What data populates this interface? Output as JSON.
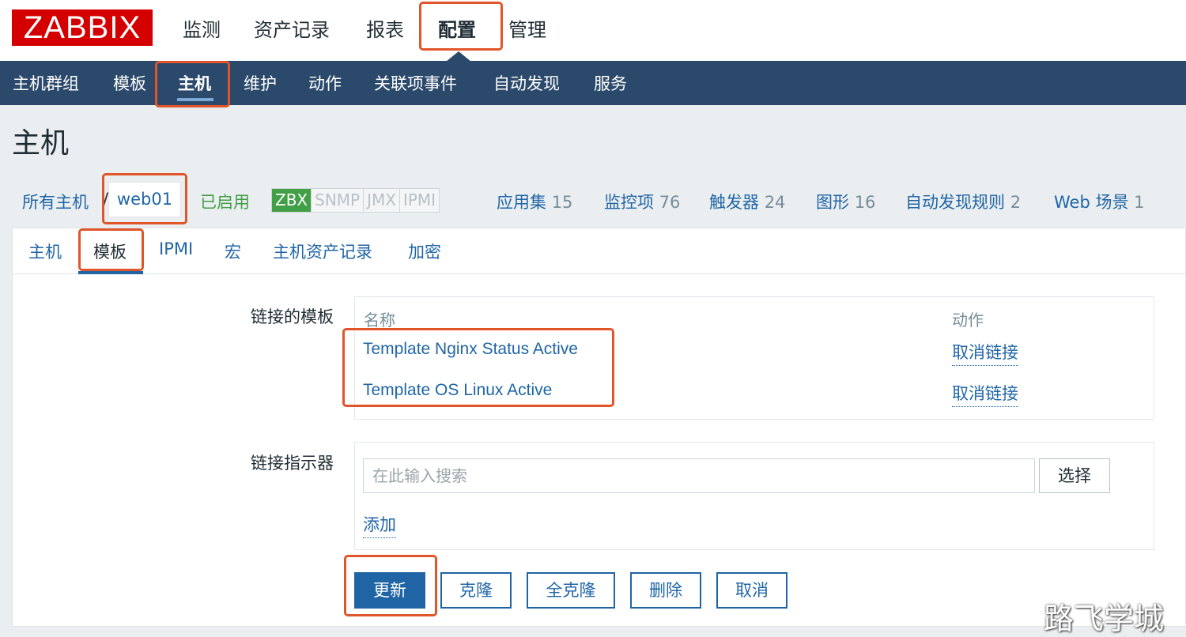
{
  "header": {
    "logo": "ZABBIX",
    "menu": [
      "监测",
      "资产记录",
      "报表",
      "配置",
      "管理"
    ]
  },
  "subnav": {
    "items": [
      "主机群组",
      "模板",
      "主机",
      "维护",
      "动作",
      "关联项事件",
      "自动发现",
      "服务"
    ]
  },
  "page_title": "主机",
  "host_bar": {
    "all_hosts": "所有主机",
    "separator": "/",
    "host_name": "web01",
    "status": "已启用",
    "availability": [
      "ZBX",
      "SNMP",
      "JMX",
      "IPMI"
    ],
    "links": [
      {
        "label": "应用集",
        "count": "15"
      },
      {
        "label": "监控项",
        "count": "76"
      },
      {
        "label": "触发器",
        "count": "24"
      },
      {
        "label": "图形",
        "count": "16"
      },
      {
        "label": "自动发现规则",
        "count": "2"
      },
      {
        "label": "Web 场景",
        "count": "1"
      }
    ]
  },
  "tabs": [
    "主机",
    "模板",
    "IPMI",
    "宏",
    "主机资产记录",
    "加密"
  ],
  "linked_templates": {
    "label": "链接的模板",
    "col_name": "名称",
    "col_action": "动作",
    "rows": [
      {
        "name": "Template Nginx Status Active",
        "action": "取消链接"
      },
      {
        "name": "Template OS Linux Active",
        "action": "取消链接"
      }
    ]
  },
  "link_new": {
    "label": "链接指示器",
    "placeholder": "在此输入搜索",
    "select_button": "选择",
    "add_link": "添加"
  },
  "buttons": {
    "update": "更新",
    "clone": "克隆",
    "full_clone": "全克隆",
    "delete": "删除",
    "cancel": "取消"
  },
  "watermark": "路飞学城",
  "colors": {
    "brand_red": "#d40000",
    "nav_bg": "#2b4a6b",
    "link_blue": "#1f65a6",
    "enabled_green": "#429e47",
    "annotation_red": "#e0552a"
  }
}
